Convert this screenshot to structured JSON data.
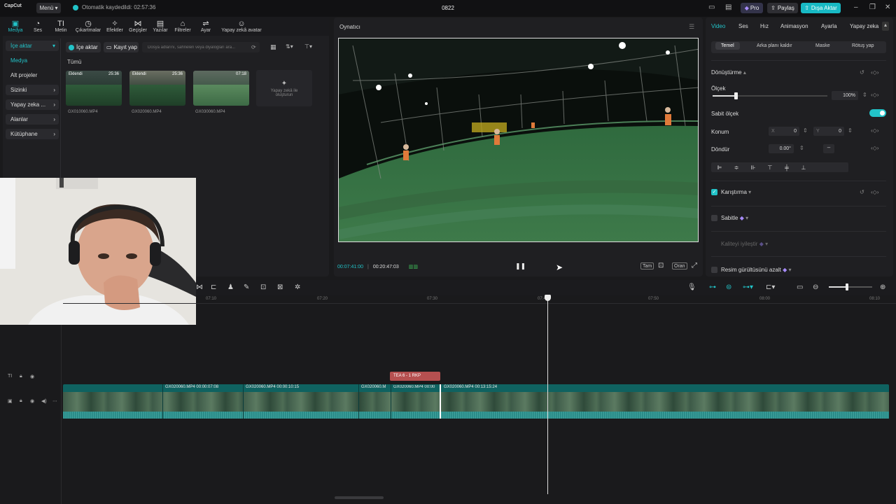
{
  "titlebar": {
    "logo": "CapCut",
    "menu_label": "Menü",
    "autosave_text": "Otomatik kaydedildi: 02:57:36",
    "project_title": "0822",
    "pro_label": "Pro",
    "share_label": "Paylaş",
    "export_label": "Dışa Aktar"
  },
  "media_tabs": [
    {
      "label": "Medya",
      "icon": "media-icon",
      "active": true
    },
    {
      "label": "Ses",
      "icon": "audio-icon"
    },
    {
      "label": "Metin",
      "icon": "text-icon"
    },
    {
      "label": "Çıkartmalar",
      "icon": "sticker-icon"
    },
    {
      "label": "Efektler",
      "icon": "effects-icon"
    },
    {
      "label": "Geçişler",
      "icon": "transitions-icon"
    },
    {
      "label": "Yazılar",
      "icon": "captions-icon"
    },
    {
      "label": "Filtreler",
      "icon": "filters-icon"
    },
    {
      "label": "Ayar",
      "icon": "adjust-icon"
    },
    {
      "label": "Yapay zekâ avatar",
      "icon": "avatar-icon"
    }
  ],
  "media_nav": {
    "import": "İçe aktar",
    "media": "Medya",
    "sub_projects": "Alt projeler",
    "yours": "Sizinki",
    "ai": "Yapay zeka ...",
    "spaces": "Alanlar",
    "library": "Kütüphane"
  },
  "media_toolbar": {
    "import_button": "İçe aktar",
    "record_button": "Kayıt yap",
    "search_placeholder": "Dosya adlarını, sahneleri veya diyalogları ara..."
  },
  "media_filter_label": "Tümü",
  "media_items": [
    {
      "name": "GX010060.MP4",
      "tag": "Eklendi",
      "duration": "25:36"
    },
    {
      "name": "GX020060.MP4",
      "tag": "Eklendi",
      "duration": "25:36"
    },
    {
      "name": "GX030060.MP4",
      "tag": "",
      "duration": "07:18"
    }
  ],
  "ai_card_label": "Yapay zekâ ile oluşturun",
  "player": {
    "title": "Oynatıcı",
    "current_time": "00:07:41:00",
    "total_time": "00:20:47:03",
    "full_label": "Tam",
    "ratio_label": "Oran"
  },
  "properties": {
    "tabs": [
      "Video",
      "Ses",
      "Hız",
      "Animasyon",
      "Ayarla",
      "Yapay zeka"
    ],
    "subtabs": [
      "Temel",
      "Arka planı kaldır",
      "Maske",
      "Rötuş yap"
    ],
    "transform_label": "Dönüştürme",
    "scale_label": "Ölçek",
    "scale_value": "100%",
    "scale_fraction": 0.2,
    "uniform_scale_label": "Sabit ölçek",
    "uniform_scale_on": true,
    "position_label": "Konum",
    "pos_x_label": "X",
    "pos_x": "0",
    "pos_y_label": "Y",
    "pos_y": "0",
    "rotate_label": "Döndür",
    "rotate_value": "0.00°",
    "blend_label": "Karıştırma",
    "stabilize_label": "Sabitle",
    "enhance_label": "Kaliteyi iyileştir",
    "denoise_label": "Resim gürültüsünü azalt"
  },
  "timeline": {
    "ruler_ticks": [
      "07:10",
      "07:20",
      "07:30",
      "07:40",
      "07:50",
      "08:00",
      "08:10"
    ],
    "text_clip": "TEA 6 - 1 RKP",
    "clips": [
      {
        "label": "GX020060.MP4   00:00:07:08"
      },
      {
        "label": "GX020060.MP4   00:00:10:15"
      },
      {
        "label": "GX020060.M"
      },
      {
        "label": "GX020060.MP4   00:00"
      },
      {
        "label": "GX020060.MP4   00:13:15:24"
      }
    ]
  },
  "colors": {
    "accent": "#22c3c8",
    "text_clip": "#b65050",
    "video_track": "#0f6260"
  }
}
